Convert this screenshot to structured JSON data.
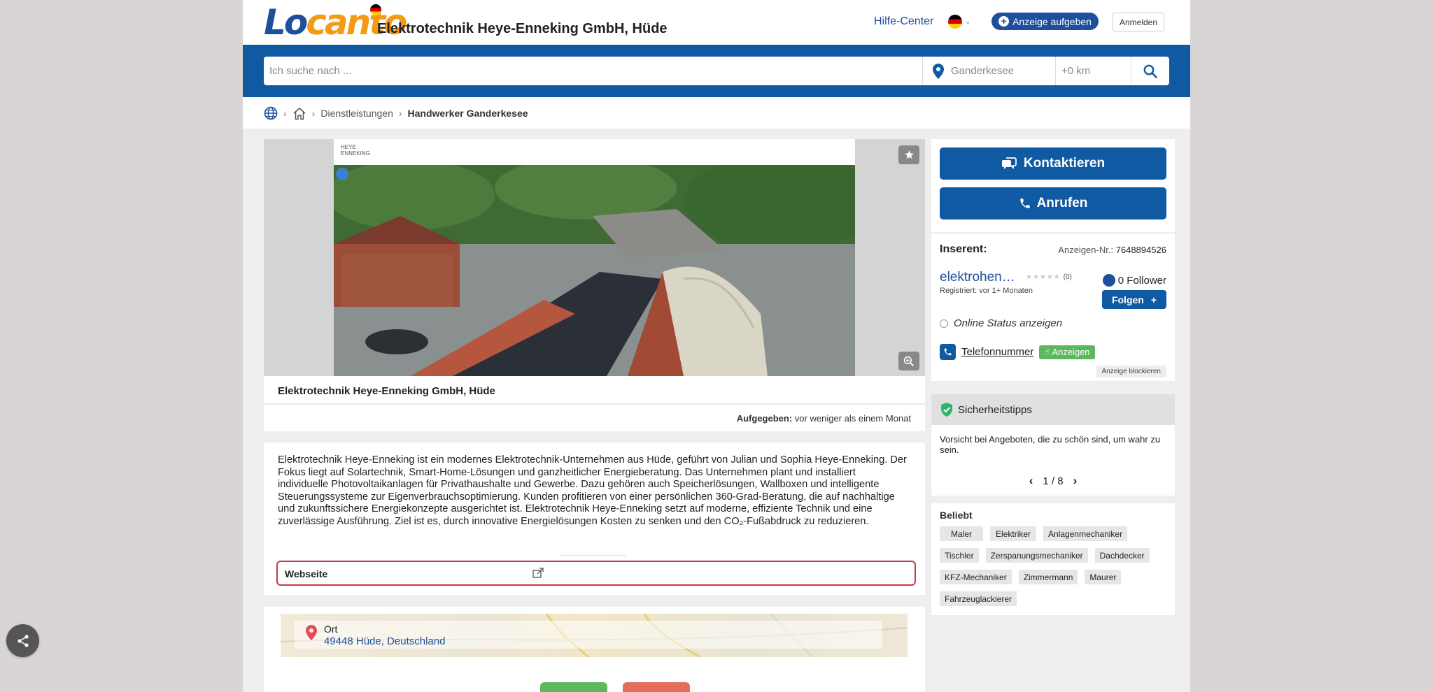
{
  "header": {
    "logo_part1": "Lo",
    "logo_part2": "canto",
    "title": "Elektrotechnik Heye-Enneking GmbH, Hüde",
    "help_link": "Hilfe-Center",
    "post_ad_button": "Anzeige aufgeben",
    "login_button": "Anmelden"
  },
  "search": {
    "placeholder": "Ich suche nach ...",
    "location": "Ganderkesee",
    "radius": "+0 km"
  },
  "breadcrumb": {
    "items": [
      "Dienstleistungen",
      "Handwerker Ganderkesee"
    ]
  },
  "listing": {
    "title": "Elektrotechnik Heye-Enneking GmbH, Hüde",
    "posted_label": "Aufgegeben:",
    "posted_value": "vor weniger als einem Monat",
    "description": "Elektrotechnik Heye-Enneking ist ein modernes Elektrotechnik-Unternehmen aus Hüde, geführt von Julian und Sophia Heye-Enneking. Der Fokus liegt auf Solartechnik, Smart-Home-Lösungen und ganzheitlicher Energieberatung. Das Unternehmen plant und installiert individuelle Photovoltaikanlagen für Privathaushalte und Gewerbe. Dazu gehören auch Speicherlösungen, Wallboxen und intelligente Steuerungssysteme zur Eigenverbrauchsoptimierung. Kunden profitieren von einer persönlichen 360-Grad-Beratung, die auf nachhaltige und zukunftssichere Energiekonzepte ausgerichtet ist. Elektrotechnik Heye-Enneking setzt auf moderne, effiziente Technik und eine zuverlässige Ausführung. Ziel ist es, durch innovative Energielösungen Kosten zu senken und den CO₂-Fußabdruck zu reduzieren.",
    "website_label": "Webseite",
    "location_label": "Ort",
    "location_value": "49448 Hüde, Deutschland"
  },
  "contact": {
    "contact_button": "Kontaktieren",
    "call_button": "Anrufen"
  },
  "seller": {
    "label": "Inserent:",
    "ad_number_label": "Anzeigen-Nr.:",
    "ad_number": "7648894526",
    "name": "elektrohen…",
    "rating_count": "(0)",
    "registered": "Registriert: vor 1+ Monaten",
    "followers": "0 Follower",
    "follow_button": "Folgen",
    "online_status": "Online Status anzeigen",
    "phone_label": "Telefonnummer",
    "show_button": "Anzeigen",
    "block_button": "Anzeige blockieren"
  },
  "safety": {
    "title": "Sicherheitstipps",
    "text": "Vorsicht bei Angeboten, die zu schön sind, um wahr zu sein.",
    "pager": "1 / 8"
  },
  "popular": {
    "title": "Beliebt",
    "tags": [
      "Maler",
      "Elektriker",
      "Anlagenmechaniker",
      "Tischler",
      "Zerspanungsmechaniker",
      "Dachdecker",
      "KFZ-Mechaniker",
      "Zimmermann",
      "Maurer",
      "Fahrzeuglackierer"
    ]
  },
  "colors": {
    "brand_blue": "#0f5aa3",
    "logo_orange": "#f39a17",
    "accent_green": "#5cb85c",
    "highlight_red": "#c8374a"
  }
}
